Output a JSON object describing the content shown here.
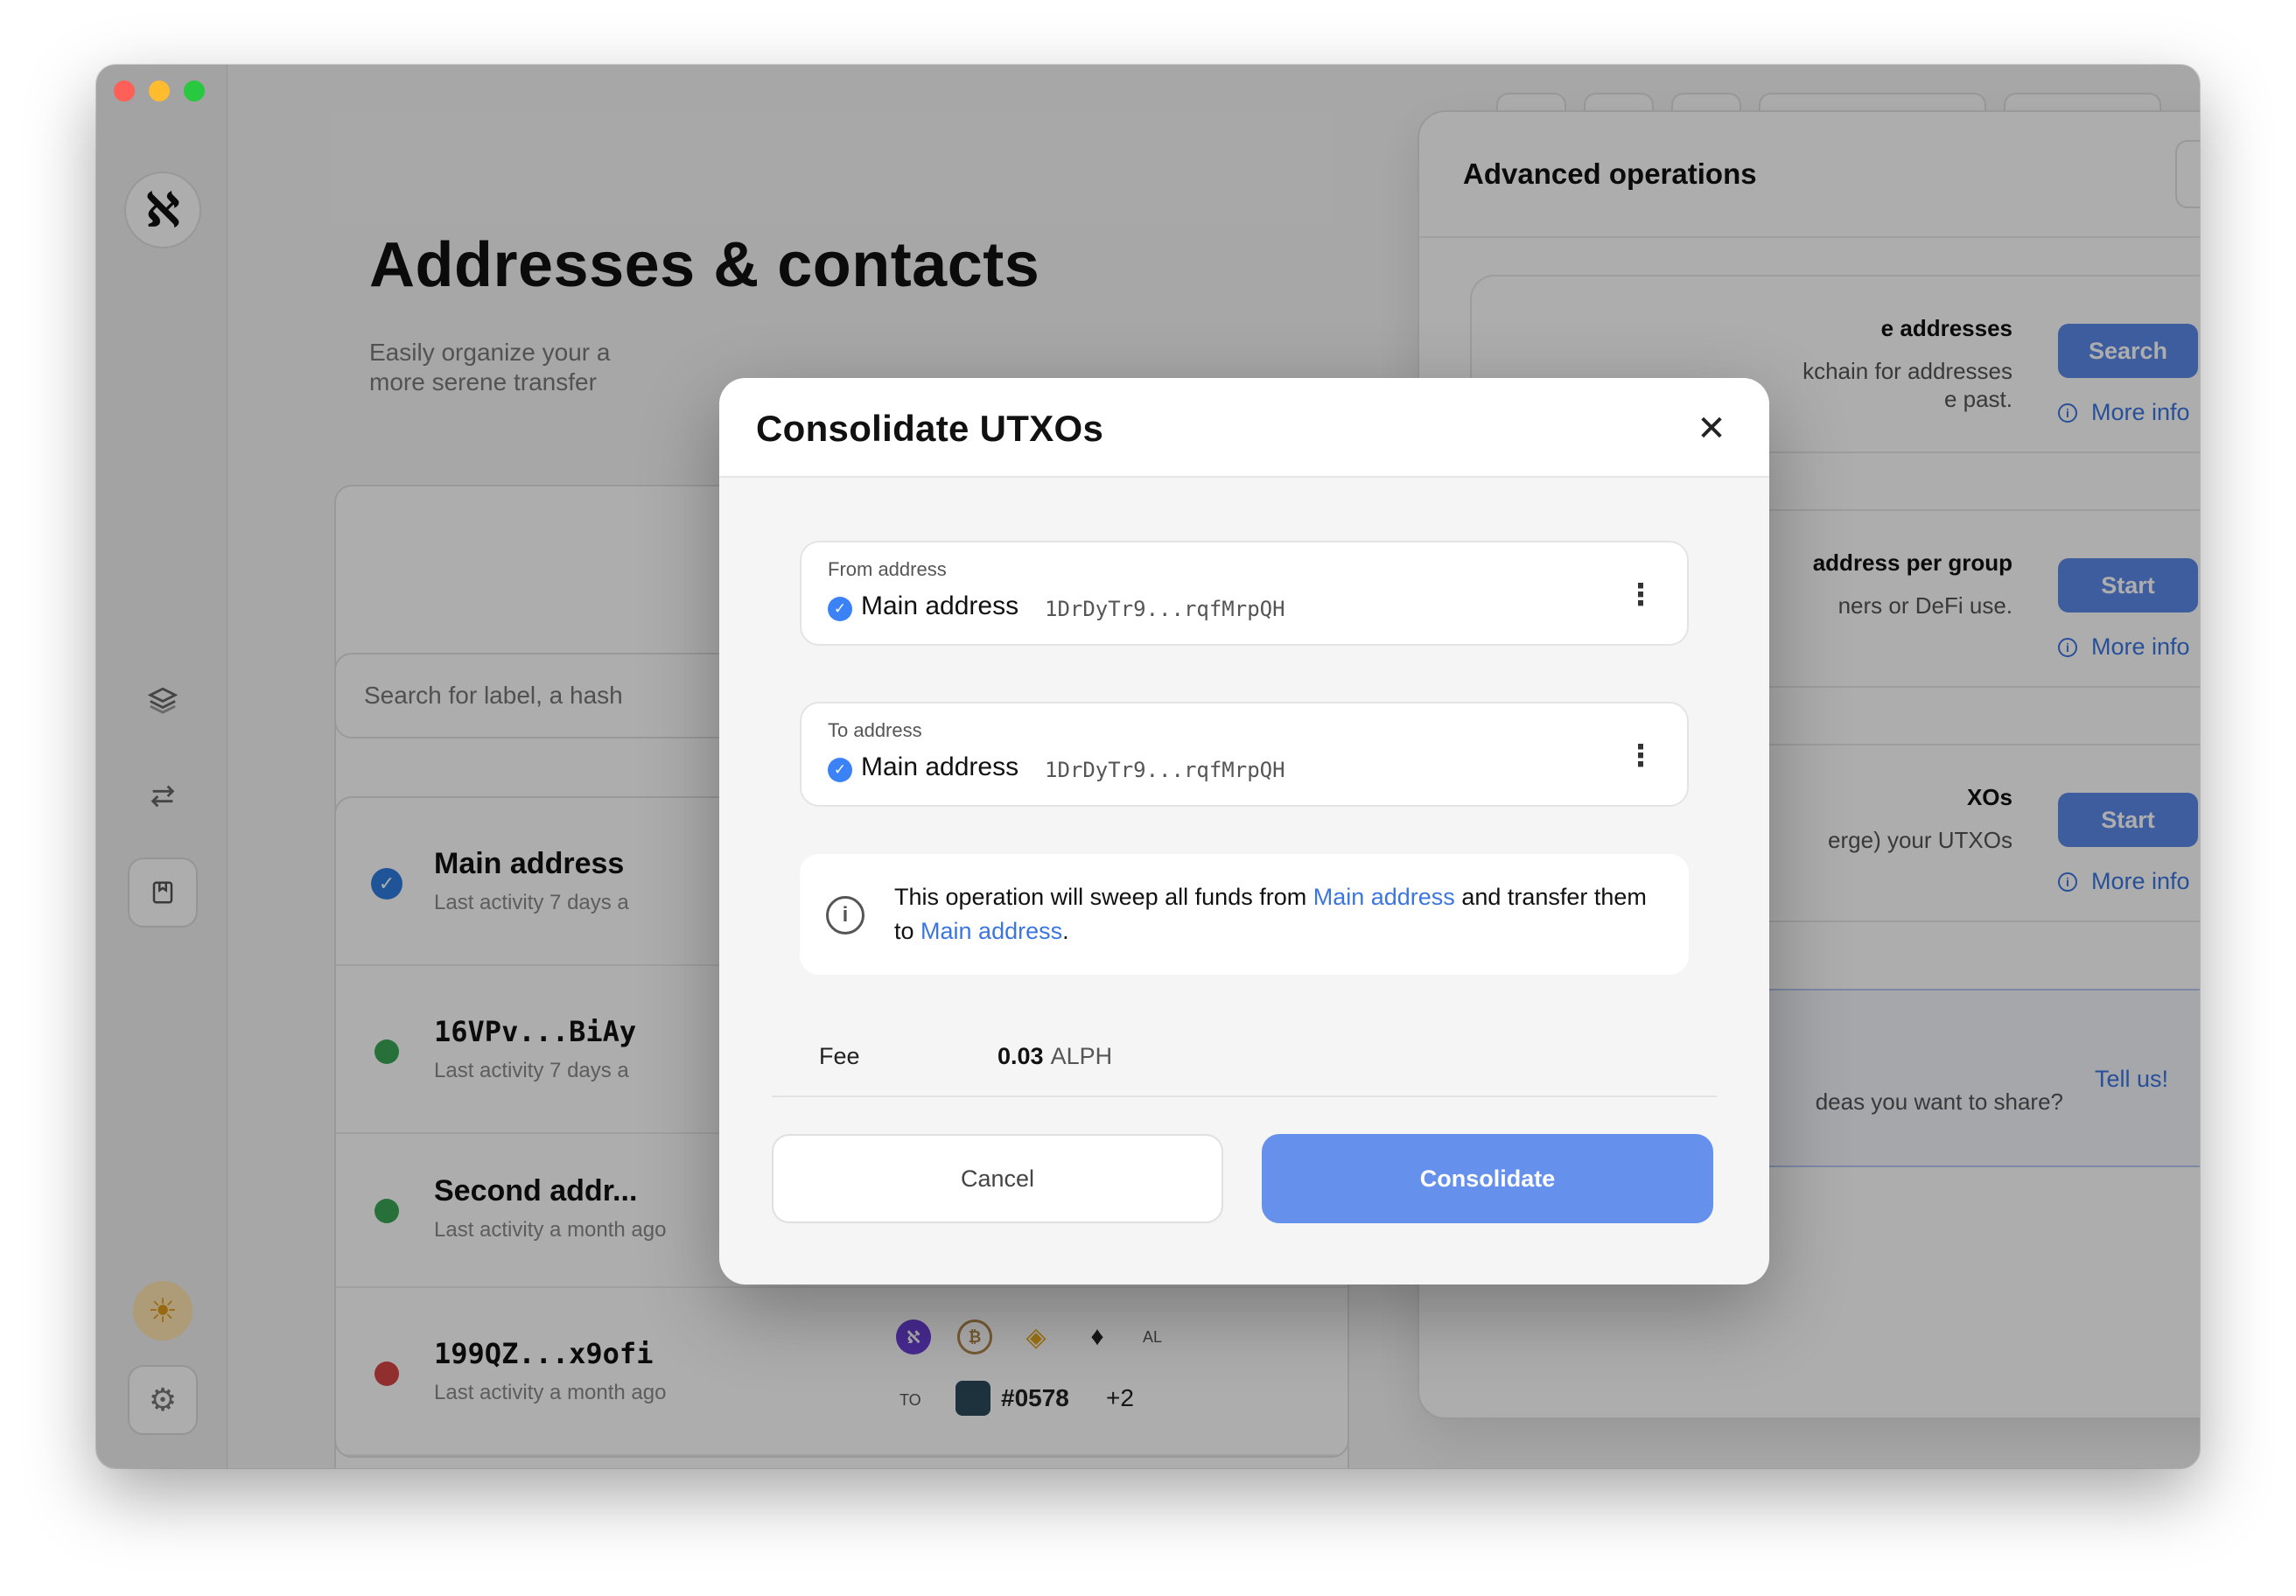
{
  "page": {
    "title": "Addresses & contacts",
    "subtitle_line1": "Easily organize your a",
    "subtitle_line2": "more serene transfer",
    "search_placeholder": "Search for label, a hash"
  },
  "sidebar": {
    "logo": "ℵ"
  },
  "addresses": [
    {
      "name": "Main address",
      "activity": "Last activity 7 days a",
      "status": "verified"
    },
    {
      "name": "16VPv...BiAy",
      "activity": "Last activity 7 days a",
      "status": "green"
    },
    {
      "name": "Second addr...",
      "activity": "Last activity a month ago",
      "status": "green"
    },
    {
      "name": "199QZ...x9ofi",
      "activity": "Last activity a month ago",
      "status": "red"
    }
  ],
  "tokens_row": {
    "al_label": "AL",
    "to_label": "TO",
    "nft_label": "#0578",
    "extra": "+2"
  },
  "advanced": {
    "title": "Advanced operations",
    "cards": [
      {
        "title": "e addresses",
        "desc_line1": "kchain for addresses",
        "desc_line2": "e past.",
        "button": "Search",
        "info": "More info"
      },
      {
        "title": "address per group",
        "desc_line1": "ners or DeFi use.",
        "desc_line2": "",
        "button": "Start",
        "info": "More info"
      },
      {
        "title": "XOs",
        "desc_line1": "erge) your UTXOs",
        "desc_line2": "",
        "button": "Start",
        "info": "More info"
      }
    ],
    "feedback_desc": "deas you want to share?",
    "feedback_link": "Tell us!"
  },
  "modal": {
    "title": "Consolidate UTXOs",
    "from_label": "From address",
    "from_name": "Main address",
    "from_hash": "1DrDyTr9...rqfMrpQH",
    "to_label": "To address",
    "to_name": "Main address",
    "to_hash": "1DrDyTr9...rqfMrpQH",
    "note_pre": "This operation will sweep all funds from ",
    "note_link1": "Main address",
    "note_mid": " and transfer them to ",
    "note_link2": "Main address",
    "note_end": ".",
    "fee_label": "Fee",
    "fee_value": "0.03",
    "fee_unit": "ALPH",
    "cancel": "Cancel",
    "confirm": "Consolidate"
  },
  "colors": {
    "accent": "#6591ec",
    "link": "#3b76e0",
    "verified": "#2f7de1",
    "status_green": "#3aa655",
    "status_red": "#d64545"
  }
}
